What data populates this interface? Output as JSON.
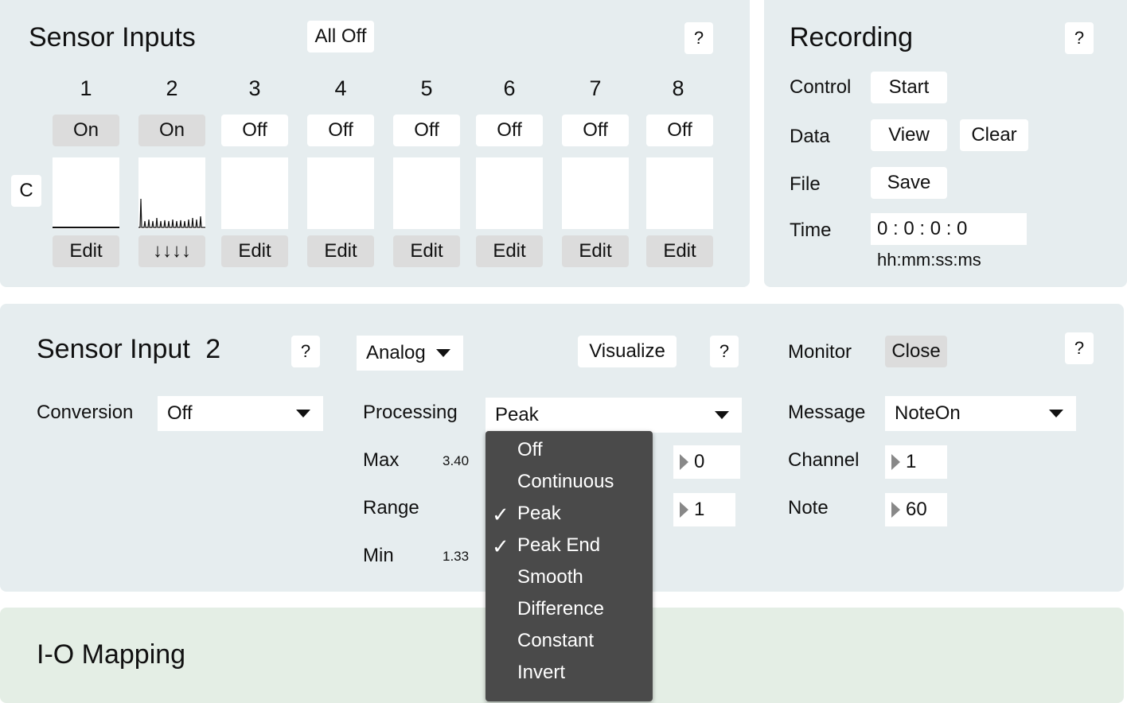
{
  "sensor_inputs": {
    "title": "Sensor Inputs",
    "all_off_label": "All Off",
    "help_label": "?",
    "c_label": "C",
    "channels": [
      {
        "number": "1",
        "state": "On",
        "edit": "Edit"
      },
      {
        "number": "2",
        "state": "On",
        "edit": "↓↓↓↓"
      },
      {
        "number": "3",
        "state": "Off",
        "edit": "Edit"
      },
      {
        "number": "4",
        "state": "Off",
        "edit": "Edit"
      },
      {
        "number": "5",
        "state": "Off",
        "edit": "Edit"
      },
      {
        "number": "6",
        "state": "Off",
        "edit": "Edit"
      },
      {
        "number": "7",
        "state": "Off",
        "edit": "Edit"
      },
      {
        "number": "8",
        "state": "Off",
        "edit": "Edit"
      }
    ]
  },
  "recording": {
    "title": "Recording",
    "help_label": "?",
    "control_label": "Control",
    "start_label": "Start",
    "data_label": "Data",
    "view_label": "View",
    "clear_label": "Clear",
    "file_label": "File",
    "save_label": "Save",
    "time_label": "Time",
    "time_value": "0 : 0 : 0 : 0",
    "time_format": "hh:mm:ss:ms"
  },
  "sensor_input_detail": {
    "title": "Sensor Input",
    "channel_number": "2",
    "help_label": "?",
    "type_select": "Analog",
    "visualize_label": "Visualize",
    "help2_label": "?",
    "conversion_label": "Conversion",
    "conversion_value": "Off",
    "processing_label": "Processing",
    "processing_value": "Peak",
    "max_label": "Max",
    "max_value": "3.40",
    "range_label": "Range",
    "min_label": "Min",
    "min_value": "1.33",
    "param1_value": "0",
    "param2_value": "1"
  },
  "monitor": {
    "monitor_label": "Monitor",
    "close_label": "Close",
    "help_label": "?",
    "message_label": "Message",
    "message_value": "NoteOn",
    "channel_label": "Channel",
    "channel_value": "1",
    "note_label": "Note",
    "note_value": "60"
  },
  "processing_dropdown": {
    "items": [
      {
        "label": "Off",
        "checked": false
      },
      {
        "label": "Continuous",
        "checked": false
      },
      {
        "label": "Peak",
        "checked": true
      },
      {
        "label": "Peak End",
        "checked": true
      },
      {
        "label": "Smooth",
        "checked": false
      },
      {
        "label": "Difference",
        "checked": false
      },
      {
        "label": "Constant",
        "checked": false
      },
      {
        "label": "Invert",
        "checked": false
      }
    ],
    "check_glyph": "✓"
  },
  "io_mapping": {
    "title": "I-O Mapping"
  },
  "colors": {
    "panel_bg": "#e6edef",
    "io_panel_bg": "#e4eee5",
    "button_on_bg": "#dcdcdc",
    "dropdown_bg": "#4a4a4a"
  }
}
